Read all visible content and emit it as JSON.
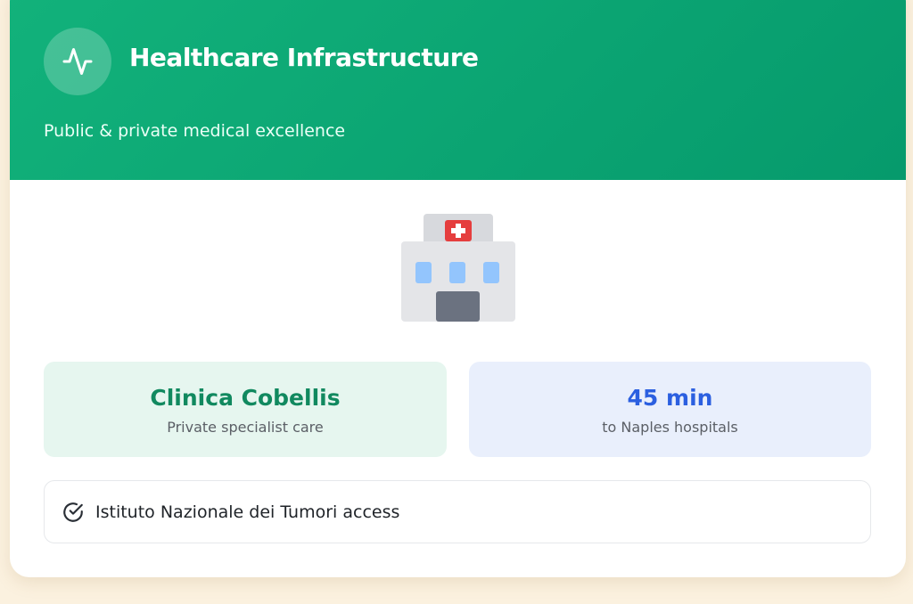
{
  "header": {
    "icon": "pulse-icon",
    "title": "Healthcare Infrastructure",
    "subtitle": "Public & private medical excellence"
  },
  "illustration": {
    "icon": "hospital-icon"
  },
  "stats": [
    {
      "value": "Clinica Cobellis",
      "label": "Private specialist care",
      "color": "#11895f"
    },
    {
      "value": "45 min",
      "label": "to Naples hospitals",
      "color": "#2b5fe0"
    }
  ],
  "features": [
    {
      "icon": "check-circle-icon",
      "text": "Istituto Nazionale dei Tumori access"
    }
  ],
  "colors": {
    "brand_green": "#069a6c",
    "accent_blue": "#2b5fe0",
    "page_background": "#fbf1df"
  }
}
